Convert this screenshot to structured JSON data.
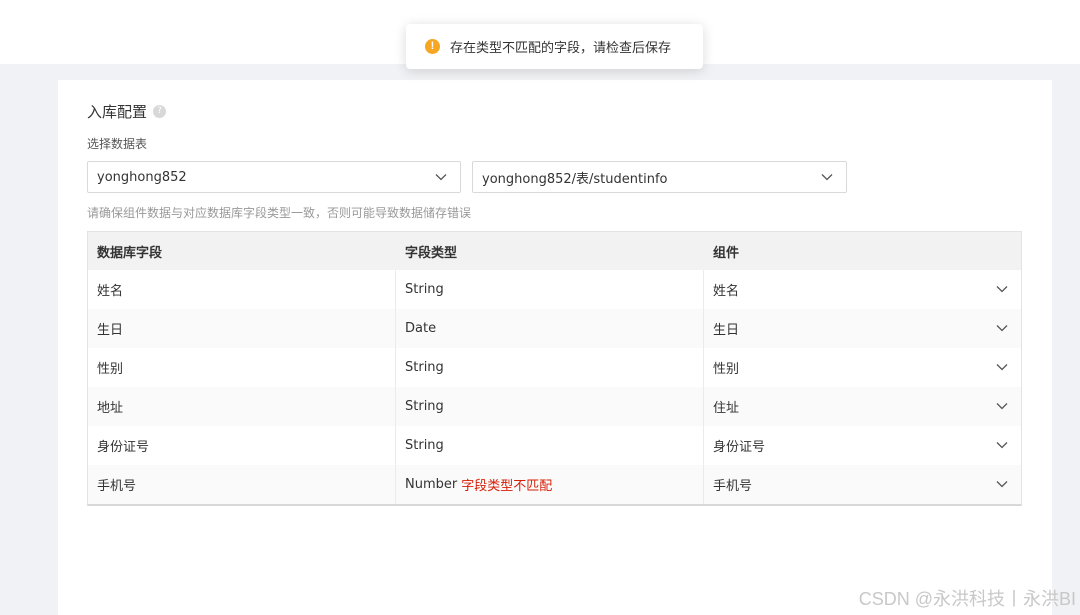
{
  "toast": {
    "icon": "warning-icon",
    "message": "存在类型不匹配的字段，请检查后保存"
  },
  "config": {
    "title": "入库配置",
    "help": "?",
    "select_label": "选择数据表",
    "database_select": "yonghong852",
    "table_select": "yonghong852/表/studentinfo",
    "hint": "请确保组件数据与对应数据库字段类型一致，否则可能导致数据储存错误"
  },
  "table": {
    "headers": [
      "数据库字段",
      "字段类型",
      "组件"
    ],
    "rows": [
      {
        "field": "姓名",
        "type": "String",
        "error": "",
        "component": "姓名"
      },
      {
        "field": "生日",
        "type": "Date",
        "error": "",
        "component": "生日"
      },
      {
        "field": "性别",
        "type": "String",
        "error": "",
        "component": "性别"
      },
      {
        "field": "地址",
        "type": "String",
        "error": "",
        "component": "住址"
      },
      {
        "field": "身份证号",
        "type": "String",
        "error": "",
        "component": "身份证号"
      },
      {
        "field": "手机号",
        "type": "Number",
        "error": "字段类型不匹配",
        "component": "手机号"
      }
    ]
  },
  "watermark": "CSDN @永洪科技丨永洪BI",
  "colors": {
    "warning": "#f5a623",
    "error": "#d81e06"
  }
}
